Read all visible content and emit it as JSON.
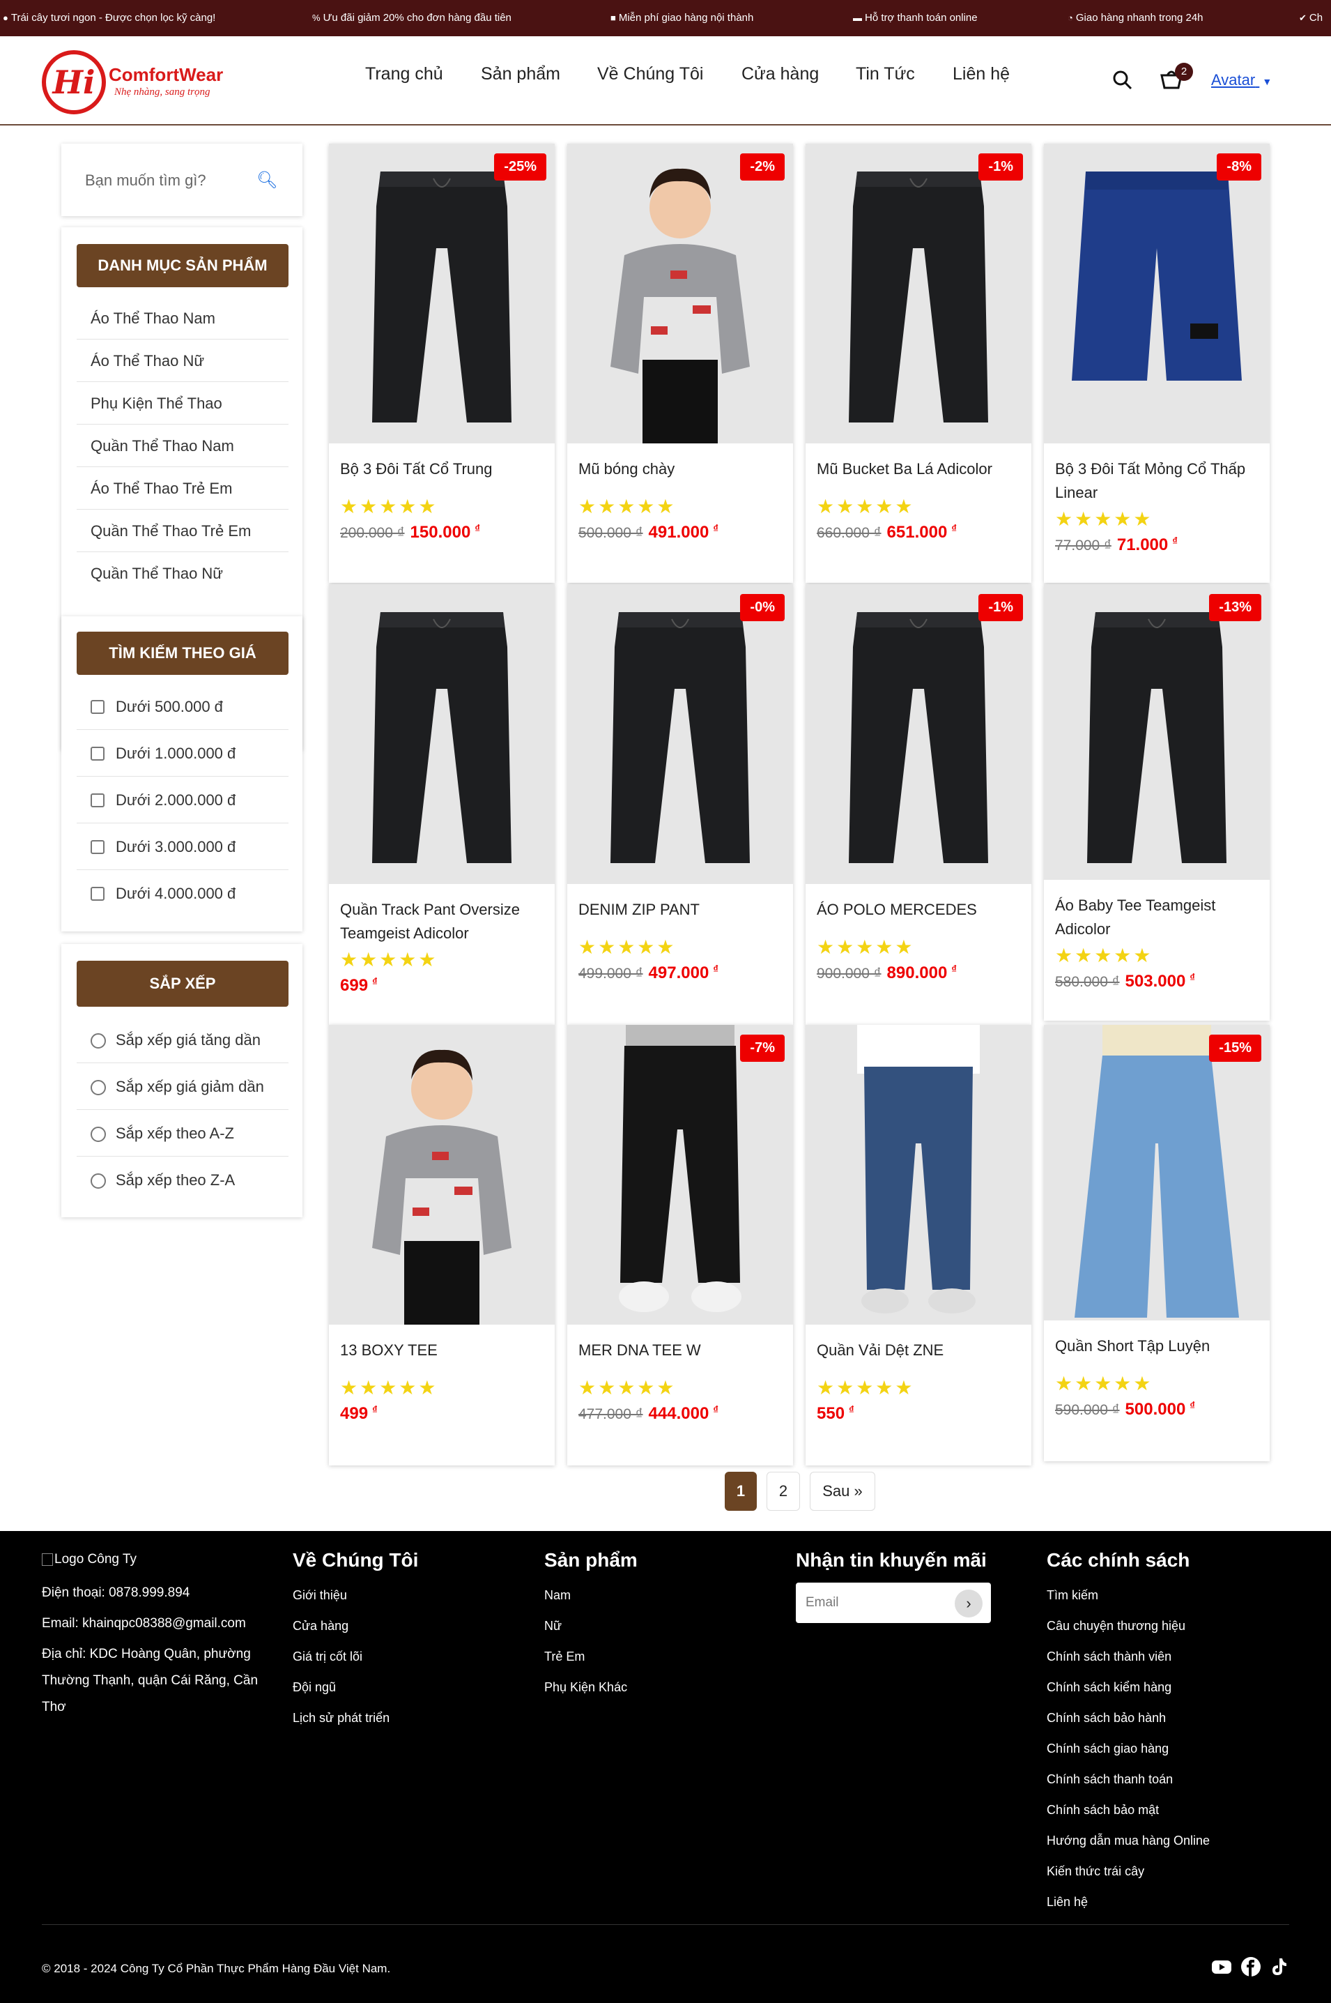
{
  "topbar": {
    "items": [
      {
        "icon": "apple-icon",
        "text": "Trái cây tươi ngon - Được chọn lọc kỹ càng!"
      },
      {
        "icon": "percent-icon",
        "text": "Ưu đãi giảm 20% cho đơn hàng đầu tiên"
      },
      {
        "icon": "truck-icon",
        "text": "Miễn phí giao hàng nội thành"
      },
      {
        "icon": "credit-card-icon",
        "text": "Hỗ trợ thanh toán online"
      },
      {
        "icon": "clock-icon",
        "text": "Giao hàng nhanh trong 24h"
      },
      {
        "icon": "check-circle-icon",
        "text": "Ch"
      }
    ],
    "bg_color": "#4a1212"
  },
  "header": {
    "logo_text": "Hi",
    "brand": "ComfortWear",
    "slogan": "Nhẹ nhàng, sang trọng",
    "nav": [
      "Trang chủ",
      "Sản phẩm",
      "Về Chúng Tôi",
      "Cửa hàng",
      "Tin Tức",
      "Liên hệ"
    ],
    "cart_count": "2",
    "avatar_alt": "Avatar"
  },
  "sidebar": {
    "search_placeholder": "Bạn muốn tìm gì?",
    "category_title": "DANH MỤC SẢN PHẨM",
    "categories": [
      "Áo Thể Thao Nam",
      "Áo Thể Thao Nữ",
      "Phụ Kiện Thể Thao",
      "Quần Thể Thao Nam",
      "Áo Thể Thao Trẻ Em",
      "Quần Thể Thao Trẻ Em",
      "Quần Thể Thao Nữ"
    ],
    "price_title": "TÌM KIẾM THEO GIÁ",
    "price_filters": [
      "Dưới 500.000 đ",
      "Dưới 1.000.000 đ",
      "Dưới 2.000.000 đ",
      "Dưới 3.000.000 đ",
      "Dưới 4.000.000 đ"
    ],
    "sort_title": "SẮP XẾP",
    "sort_options": [
      "Sắp xếp giá tăng dần",
      "Sắp xếp giá giảm dần",
      "Sắp xếp theo A-Z",
      "Sắp xếp theo Z-A"
    ],
    "accent_color": "#6b4423"
  },
  "products": [
    {
      "name": "Bộ 3 Đôi Tất Cổ Trung",
      "discount": "-25%",
      "old_price": "200.000 ₫",
      "price": "150.000",
      "currency": "₫",
      "image": "black-pants",
      "rating": 5
    },
    {
      "name": "Mũ bóng chày",
      "discount": "-2%",
      "old_price": "500.000 ₫",
      "price": "491.000",
      "currency": "₫",
      "image": "boy-sweater",
      "rating": 5
    },
    {
      "name": "Mũ Bucket Ba Lá Adicolor",
      "discount": "-1%",
      "old_price": "660.000 ₫",
      "price": "651.000",
      "currency": "₫",
      "image": "black-pants",
      "rating": 5
    },
    {
      "name": "Bộ 3 Đôi Tất Mỏng Cổ Thấp Linear",
      "discount": "-8%",
      "old_price": "77.000 ₫",
      "price": "71.000",
      "currency": "₫",
      "image": "blue-shorts",
      "rating": 5
    },
    {
      "name": "Quần Track Pant Oversize Teamgeist Adicolor",
      "discount": "",
      "old_price": "",
      "price": "699",
      "currency": "₫",
      "image": "black-pants",
      "rating": 5
    },
    {
      "name": "DENIM ZIP PANT",
      "discount": "-0%",
      "old_price": "499.000 ₫",
      "price": "497.000",
      "currency": "₫",
      "image": "black-pants",
      "rating": 5
    },
    {
      "name": "ÁO POLO MERCEDES",
      "discount": "-1%",
      "old_price": "900.000 ₫",
      "price": "890.000",
      "currency": "₫",
      "image": "black-pants",
      "rating": 5
    },
    {
      "name": "Áo Baby Tee Teamgeist Adicolor",
      "discount": "-13%",
      "old_price": "580.000 ₫",
      "price": "503.000",
      "currency": "₫",
      "image": "black-pants",
      "rating": 5
    },
    {
      "name": "13 BOXY TEE",
      "discount": "",
      "old_price": "",
      "price": "499",
      "currency": "₫",
      "image": "boy-sweater",
      "rating": 5
    },
    {
      "name": "MER DNA TEE W",
      "discount": "-7%",
      "old_price": "477.000 ₫",
      "price": "444.000",
      "currency": "₫",
      "image": "jogger",
      "rating": 5
    },
    {
      "name": "Quần Vải Dệt ZNE",
      "discount": "",
      "old_price": "",
      "price": "550",
      "currency": "₫",
      "image": "jeans",
      "rating": 5
    },
    {
      "name": "Quần Short Tập Luyện",
      "discount": "-15%",
      "old_price": "590.000 ₫",
      "price": "500.000",
      "currency": "₫",
      "image": "wide-jeans",
      "rating": 5
    }
  ],
  "pagination": {
    "pages": [
      "1",
      "2"
    ],
    "current": "1",
    "next": "Sau »"
  },
  "footer": {
    "logo_alt": "Logo Công Ty",
    "phone": "Điện thoại: 0878.999.894",
    "email": "Email: khainqpc08388@gmail.com",
    "address": "Địa chỉ: KDC Hoàng Quân, phường Thường Thạnh, quận Cái Răng, Cần Thơ",
    "about_title": "Về Chúng Tôi",
    "about_links": [
      "Giới thiệu",
      "Cửa hàng",
      "Giá trị cốt lõi",
      "Đội ngũ",
      "Lịch sử phát triển"
    ],
    "products_title": "Sản phẩm",
    "products_links": [
      "Nam",
      "Nữ",
      "Trẻ Em",
      "Phụ Kiện Khác"
    ],
    "newsletter_title": "Nhận tin khuyến mãi",
    "email_placeholder": "Email",
    "policy_title": "Các chính sách",
    "policy_links": [
      "Tìm kiếm",
      "Câu chuyện thương hiệu",
      "Chính sách thành viên",
      "Chính sách kiểm hàng",
      "Chính sách bảo hành",
      "Chính sách giao hàng",
      "Chính sách thanh toán",
      "Chính sách bảo mật",
      "Hướng dẫn mua hàng Online",
      "Kiến thức trái cây",
      "Liên hệ"
    ],
    "copyright": "© 2018 - 2024 Công Ty Cổ Phần Thực Phẩm Hàng Đầu Việt Nam.",
    "social": [
      "youtube-icon",
      "facebook-icon",
      "tiktok-icon"
    ]
  }
}
